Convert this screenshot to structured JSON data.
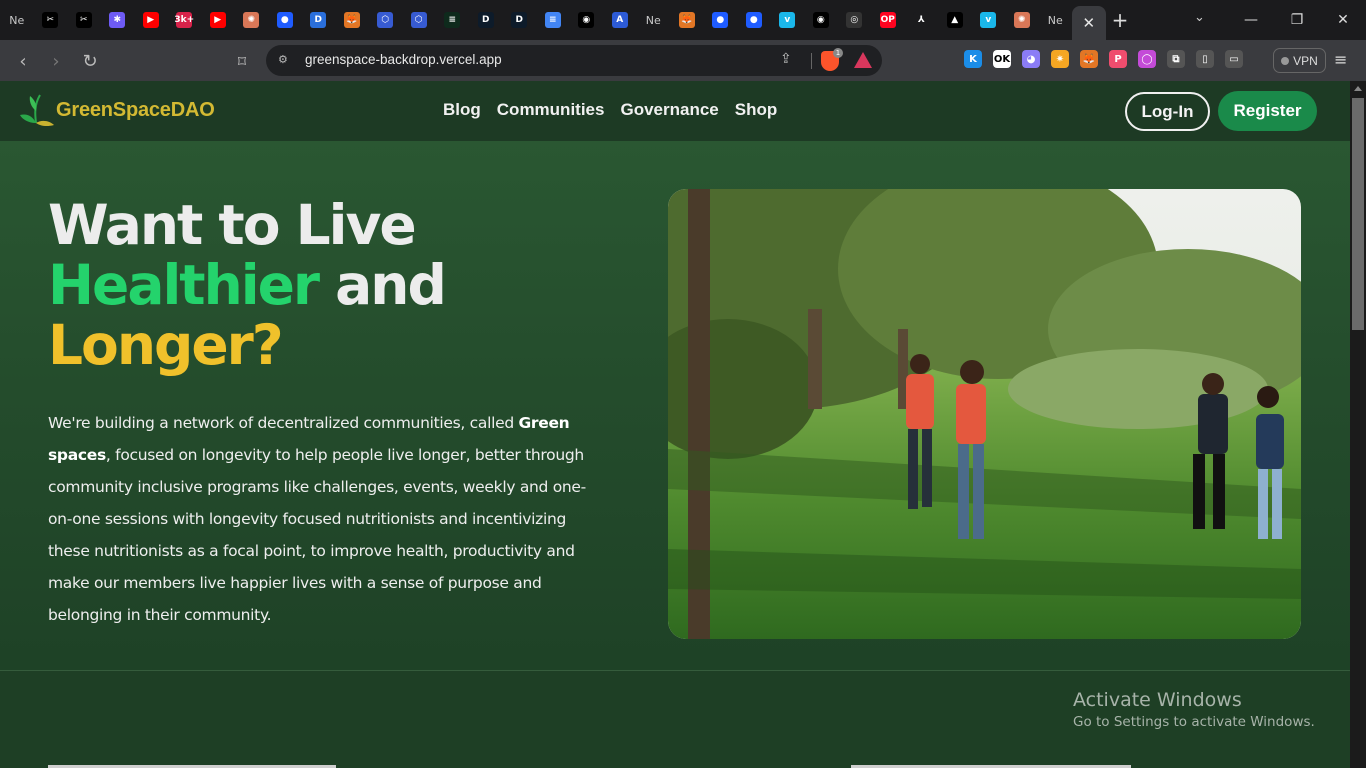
{
  "browser": {
    "tabs": [
      {
        "name": "tab-ne",
        "glyph": "Ne",
        "color": "#1b1b1d"
      },
      {
        "name": "tab-capcut-1",
        "glyph": "✂",
        "color": "#000000"
      },
      {
        "name": "tab-capcut-2",
        "glyph": "✂",
        "color": "#000000"
      },
      {
        "name": "tab-snowflake",
        "glyph": "✱",
        "color": "#6e5bf5"
      },
      {
        "name": "tab-youtube-1",
        "glyph": "▶",
        "color": "#ff0000"
      },
      {
        "name": "tab-3k",
        "glyph": "3k+",
        "color": "#d8224a"
      },
      {
        "name": "tab-youtube-2",
        "glyph": "▶",
        "color": "#ff0000"
      },
      {
        "name": "tab-claude",
        "glyph": "✺",
        "color": "#d97757"
      },
      {
        "name": "tab-blue-1",
        "glyph": "●",
        "color": "#1f5cff"
      },
      {
        "name": "tab-doc",
        "glyph": "D",
        "color": "#2a6fdb"
      },
      {
        "name": "tab-metamask-1",
        "glyph": "🦊",
        "color": "#e27625"
      },
      {
        "name": "tab-chainlink-1",
        "glyph": "⬡",
        "color": "#375bd2"
      },
      {
        "name": "tab-chainlink-2",
        "glyph": "⬡",
        "color": "#375bd2"
      },
      {
        "name": "tab-green",
        "glyph": "≡",
        "color": "#0e2a1c"
      },
      {
        "name": "tab-d-1",
        "glyph": "D",
        "color": "#0d1b2a"
      },
      {
        "name": "tab-d-2",
        "glyph": "D",
        "color": "#0d1b2a"
      },
      {
        "name": "tab-docs",
        "glyph": "≡",
        "color": "#4285f4"
      },
      {
        "name": "tab-github-1",
        "glyph": "◉",
        "color": "#000000"
      },
      {
        "name": "tab-arb",
        "glyph": "A",
        "color": "#2d5bd6"
      },
      {
        "name": "tab-ne-2",
        "glyph": "Ne",
        "color": "#1b1b1d"
      },
      {
        "name": "tab-metamask-2",
        "glyph": "🦊",
        "color": "#e27625"
      },
      {
        "name": "tab-blue-2",
        "glyph": "●",
        "color": "#1f5cff"
      },
      {
        "name": "tab-blue-3",
        "glyph": "●",
        "color": "#1f5cff"
      },
      {
        "name": "tab-vimeo-1",
        "glyph": "v",
        "color": "#1ab7ea"
      },
      {
        "name": "tab-github-2",
        "glyph": "◉",
        "color": "#000000"
      },
      {
        "name": "tab-owl",
        "glyph": "◎",
        "color": "#333333"
      },
      {
        "name": "tab-op",
        "glyph": "OP",
        "color": "#ff0420"
      },
      {
        "name": "tab-celo",
        "glyph": "⅄",
        "color": "#1b1b1d"
      },
      {
        "name": "tab-triangle",
        "glyph": "▲",
        "color": "#000000"
      },
      {
        "name": "tab-vimeo-2",
        "glyph": "v",
        "color": "#1ab7ea"
      },
      {
        "name": "tab-claude-2",
        "glyph": "✺",
        "color": "#d97757"
      },
      {
        "name": "tab-ne-3",
        "glyph": "Ne",
        "color": "#1b1b1d"
      }
    ],
    "active_tab_close": "✕",
    "new_tab": "+",
    "tab_list": "⌄",
    "window_controls": {
      "minimize": "—",
      "restore": "❐",
      "close": "✕"
    },
    "back": "‹",
    "forward": "›",
    "reload": "↻",
    "bookmark": "⌑",
    "url": "greenspace-backdrop.vercel.app",
    "shield_badge": "1",
    "extensions": [
      {
        "name": "k-extension",
        "glyph": "K",
        "color": "#1b8de8"
      },
      {
        "name": "okx-extension",
        "glyph": "OK",
        "color": "#ffffff"
      },
      {
        "name": "ghost-extension",
        "glyph": "◕",
        "color": "#8b7cf6"
      },
      {
        "name": "burst-extension",
        "glyph": "✷",
        "color": "#f5a623"
      },
      {
        "name": "metamask-extension",
        "glyph": "🦊",
        "color": "#e27625"
      },
      {
        "name": "p-extension",
        "glyph": "P",
        "color": "#ef4d6e"
      },
      {
        "name": "color-extension",
        "glyph": "◯",
        "color": "#c44bd8"
      },
      {
        "name": "puzzle-extension",
        "glyph": "⧉",
        "color": "#555555"
      },
      {
        "name": "sidebar-extension",
        "glyph": "▯",
        "color": "#555555"
      },
      {
        "name": "wallet-extension",
        "glyph": "▭",
        "color": "#555555"
      }
    ],
    "vpn_label": "VPN",
    "menu": "≡"
  },
  "site": {
    "logo_text": "GreenSpaceDAO",
    "nav": [
      "Blog",
      "Communities",
      "Governance",
      "Shop"
    ],
    "login_label": "Log-In",
    "register_label": "Register",
    "hero": {
      "line1": "Want to Live",
      "line2_highlight": "Healthier",
      "line2_rest": " and",
      "line3": "Longer?",
      "desc_before": "We're building a network of decentralized communities, called ",
      "desc_bold": "Green spaces",
      "desc_after": ", focused on longevity to help people live longer, better through community inclusive programs like challenges, events, weekly and one-on-one sessions with longevity focused nutritionists and incentivizing these nutritionists as a focal point, to improve health, productivity and make our members live happier lives with a sense of purpose and belonging in their community."
    }
  },
  "os_overlay": {
    "title": "Activate Windows",
    "subtitle": "Go to Settings to activate Windows."
  },
  "colors": {
    "accent_green": "#24d36c",
    "accent_yellow": "#f0c12b",
    "register_bg": "#1a8a4a",
    "header_bg": "#1d3a24"
  }
}
